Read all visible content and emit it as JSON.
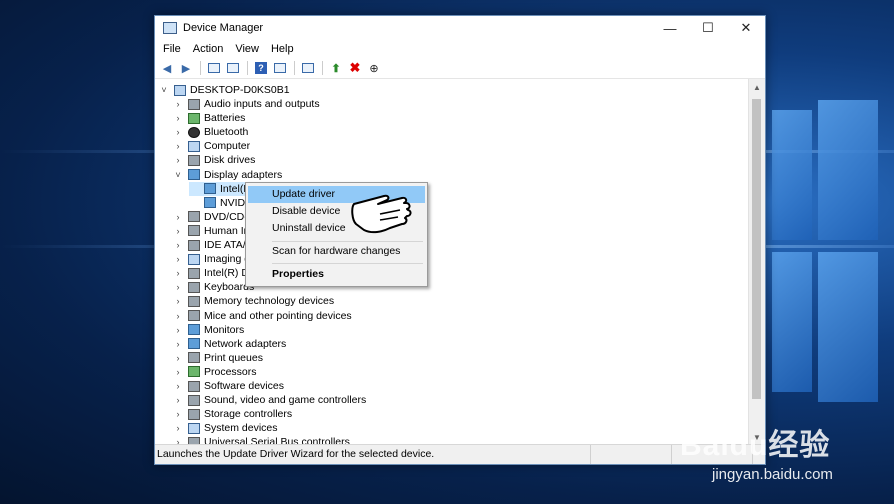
{
  "window": {
    "title": "Device Manager",
    "minimize": "—",
    "maximize": "☐",
    "close": "✕"
  },
  "menu": [
    "File",
    "Action",
    "View",
    "Help"
  ],
  "tree": {
    "root": "DESKTOP-D0KS0B1",
    "items": [
      {
        "label": "Audio inputs and outputs",
        "chev": "›"
      },
      {
        "label": "Batteries",
        "chev": "›"
      },
      {
        "label": "Bluetooth",
        "chev": "›"
      },
      {
        "label": "Computer",
        "chev": "›"
      },
      {
        "label": "Disk drives",
        "chev": "›"
      },
      {
        "label": "Display adapters",
        "chev": "˅"
      },
      {
        "label": "Intel(R",
        "chev": ""
      },
      {
        "label": "NVIDIA",
        "chev": ""
      },
      {
        "label": "DVD/CD-I",
        "chev": "›"
      },
      {
        "label": "Human In",
        "chev": "›"
      },
      {
        "label": "IDE ATA/A",
        "chev": "›"
      },
      {
        "label": "Imaging d",
        "chev": "›"
      },
      {
        "label": "Intel(R) Dy",
        "chev": "›"
      },
      {
        "label": "Keyboards",
        "chev": "›"
      },
      {
        "label": "Memory technology devices",
        "chev": "›"
      },
      {
        "label": "Mice and other pointing devices",
        "chev": "›"
      },
      {
        "label": "Monitors",
        "chev": "›"
      },
      {
        "label": "Network adapters",
        "chev": "›"
      },
      {
        "label": "Print queues",
        "chev": "›"
      },
      {
        "label": "Processors",
        "chev": "›"
      },
      {
        "label": "Software devices",
        "chev": "›"
      },
      {
        "label": "Sound, video and game controllers",
        "chev": "›"
      },
      {
        "label": "Storage controllers",
        "chev": "›"
      },
      {
        "label": "System devices",
        "chev": "›"
      },
      {
        "label": "Universal Serial Bus controllers",
        "chev": "›"
      }
    ]
  },
  "context_menu": {
    "update": "Update driver",
    "disable": "Disable device",
    "uninstall": "Uninstall device",
    "scan": "Scan for hardware changes",
    "properties": "Properties"
  },
  "status": "Launches the Update Driver Wizard for the selected device.",
  "watermark": {
    "logo": "Baidu经验",
    "url": "jingyan.baidu.com"
  }
}
